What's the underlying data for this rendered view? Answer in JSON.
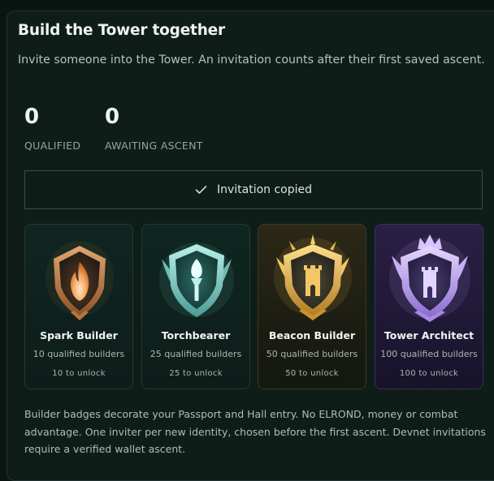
{
  "card": {
    "title": "Build the Tower together",
    "subtitle": "Invite someone into the Tower. An invitation counts after their first saved ascent."
  },
  "stats": [
    {
      "value": "0",
      "label": "QUALIFIED"
    },
    {
      "value": "0",
      "label": "AWAITING ASCENT"
    }
  ],
  "copy_button": {
    "label": "Invitation copied",
    "icon": "check-icon"
  },
  "badges": [
    {
      "name": "Spark Builder",
      "requirement": "10 qualified builders",
      "unlock": "10 to unlock",
      "icon": "flame-shield-icon",
      "accent": "#c98a52"
    },
    {
      "name": "Torchbearer",
      "requirement": "25 qualified builders",
      "unlock": "25 to unlock",
      "icon": "torch-shield-icon",
      "accent": "#7fd3cc"
    },
    {
      "name": "Beacon Builder",
      "requirement": "50 qualified builders",
      "unlock": "50 to unlock",
      "icon": "beacon-tower-shield-icon",
      "accent": "#e5b74f"
    },
    {
      "name": "Tower Architect",
      "requirement": "100 qualified builders",
      "unlock": "100 to unlock",
      "icon": "crown-tower-shield-icon",
      "accent": "#b99cf0"
    }
  ],
  "footer": {
    "text": "Builder badges decorate your Passport and Hall entry. No ELROND, money or combat advantage. One inviter per new identity, chosen before the first ascent. Devnet invitations require a verified wallet ascent."
  }
}
